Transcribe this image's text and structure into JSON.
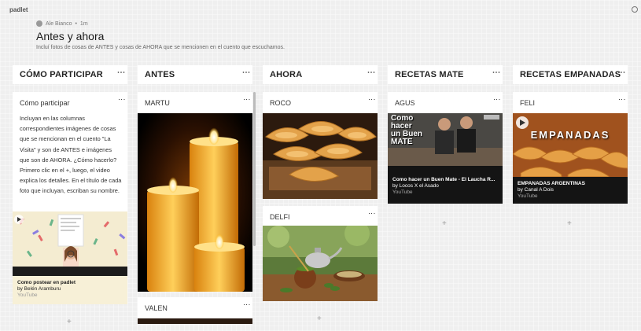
{
  "app": {
    "logo": "padlet"
  },
  "header": {
    "author": "Ale Bianco",
    "time": "1m",
    "title": "Antes y ahora",
    "description": "Incluí fotos de cosas de ANTES y cosas de AHORA que se mencionen en el cuento que escuchamos."
  },
  "columns": [
    {
      "label": "CÓMO PARTICIPAR"
    },
    {
      "label": "ANTES"
    },
    {
      "label": "AHORA"
    },
    {
      "label": "RECETAS MATE"
    },
    {
      "label": "RECETAS EMPANADAS"
    }
  ],
  "cards": {
    "como": {
      "title": "Cómo participar",
      "body": "Incluyan en las columnas correspondientes imágenes de cosas que se mencionan en el cuento \"La Visita\" y son de ANTES e imágenes que son de AHORA. ¿Cómo hacerlo? Primero clic en el +, luego, el video explica los detalles. En el título de cada foto que incluyan, escriban su nombre.",
      "embed_title": "Como postear en padlet",
      "embed_by": "by Belén Aramburu",
      "embed_source": "YouTube"
    },
    "martu": {
      "title": "MARTU"
    },
    "valen": {
      "title": "VALEN"
    },
    "roco": {
      "title": "ROCO"
    },
    "delfi": {
      "title": "DELFI"
    },
    "agus": {
      "title": "AGUS",
      "thumb_text_1": "Como",
      "thumb_text_2": "hacer",
      "thumb_text_3": "un Buen",
      "thumb_text_4": "MATE",
      "embed_title": "Como hacer un Buen Mate - El Laucha R...",
      "embed_by": "by Locos X el Asado",
      "embed_source": "YouTube"
    },
    "feli": {
      "title": "FELI",
      "thumb_text": "EMPANADAS",
      "embed_title": "EMPANADAS ARGENTINAS",
      "embed_by": "by Canal A Dois",
      "embed_source": "YouTube"
    }
  },
  "add_label": "+",
  "more_label": "⋮",
  "colors": {
    "background": "#efefef",
    "card": "#ffffff",
    "embed_cream": "#f7f0d7",
    "embed_dark": "#141414"
  }
}
